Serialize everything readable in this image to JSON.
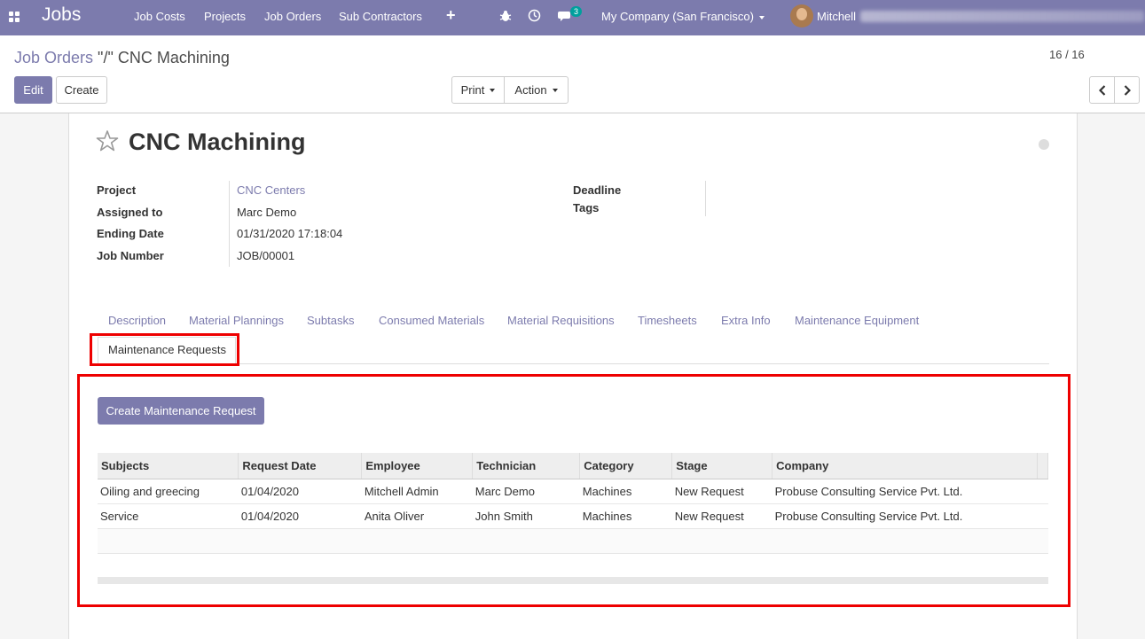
{
  "navbar": {
    "brand": "Jobs",
    "menu": [
      "Job Costs",
      "Projects",
      "Job Orders",
      "Sub Contractors"
    ],
    "add_icon": "+",
    "bug_icon": "bug-icon",
    "clock_icon": "clock-icon",
    "chat_icon": "chat-icon",
    "chat_count": "3",
    "company": "My Company (San Francisco)",
    "user": "Mitchell"
  },
  "breadcrumb": {
    "parent": "Job Orders",
    "separator": " \"/\" ",
    "current": "CNC Machining"
  },
  "buttons": {
    "edit": "Edit",
    "create": "Create",
    "print": "Print",
    "action": "Action"
  },
  "pager": {
    "value": "16 / 16"
  },
  "record": {
    "name": "CNC Machining",
    "fields_left": [
      {
        "label": "Project",
        "value": "CNC Centers"
      },
      {
        "label": "Assigned to",
        "value": "Marc Demo"
      },
      {
        "label": "Ending Date",
        "value": "01/31/2020 17:18:04"
      },
      {
        "label": "Job Number",
        "value": "JOB/00001"
      }
    ],
    "fields_right": [
      {
        "label": "Deadline",
        "value": ""
      },
      {
        "label": "Tags",
        "value": ""
      }
    ]
  },
  "tabs": [
    "Description",
    "Material Plannings",
    "Subtasks",
    "Consumed Materials",
    "Material Requisitions",
    "Timesheets",
    "Extra Info",
    "Maintenance Equipment",
    "Maintenance Requests"
  ],
  "panel": {
    "create_button": "Create Maintenance Request",
    "columns": [
      "Subjects",
      "Request Date",
      "Employee",
      "Technician",
      "Category",
      "Stage",
      "Company"
    ],
    "rows": [
      [
        "Oiling and greecing",
        "01/04/2020",
        "Mitchell Admin",
        "Marc Demo",
        "Machines",
        "New Request",
        "Probuse Consulting Service Pvt. Ltd."
      ],
      [
        "Service",
        "01/04/2020",
        "Anita Oliver",
        "John Smith",
        "Machines",
        "New Request",
        "Probuse Consulting Service Pvt. Ltd."
      ]
    ]
  },
  "colors": {
    "brand": "#7c7bad",
    "highlight": "#ee0000"
  }
}
